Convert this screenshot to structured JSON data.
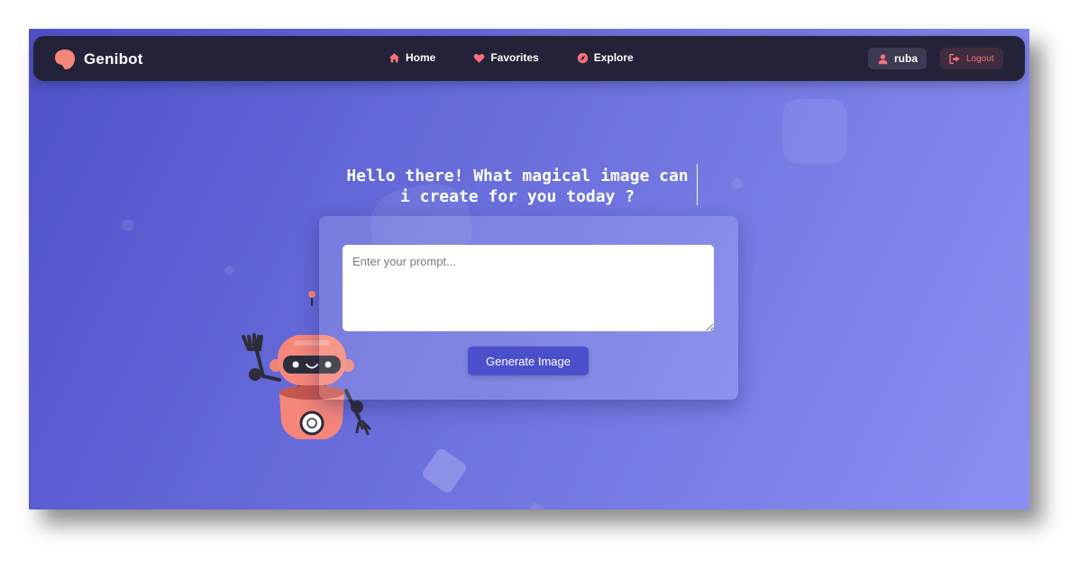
{
  "brand": {
    "name": "Genibot",
    "logo_icon": "bubble-logo-icon",
    "accent": "#f5867a"
  },
  "nav": {
    "items": [
      {
        "label": "Home",
        "icon": "home-icon"
      },
      {
        "label": "Favorites",
        "icon": "heart-icon"
      },
      {
        "label": "Explore",
        "icon": "compass-icon"
      }
    ]
  },
  "user": {
    "name": "ruba",
    "icon": "user-icon"
  },
  "logout": {
    "label": "Logout",
    "icon": "logout-icon",
    "color": "#f3707a"
  },
  "hero": {
    "headline_line1": "Hello there! What magical image can",
    "headline_line2": "i create for you today ?"
  },
  "prompt": {
    "placeholder": "Enter your prompt...",
    "value": "",
    "button_label": "Generate Image"
  },
  "colors": {
    "navbar": "#232239",
    "button": "#4c4fcc",
    "bg_start": "#4f52c9",
    "bg_end": "#8a8ff3"
  }
}
